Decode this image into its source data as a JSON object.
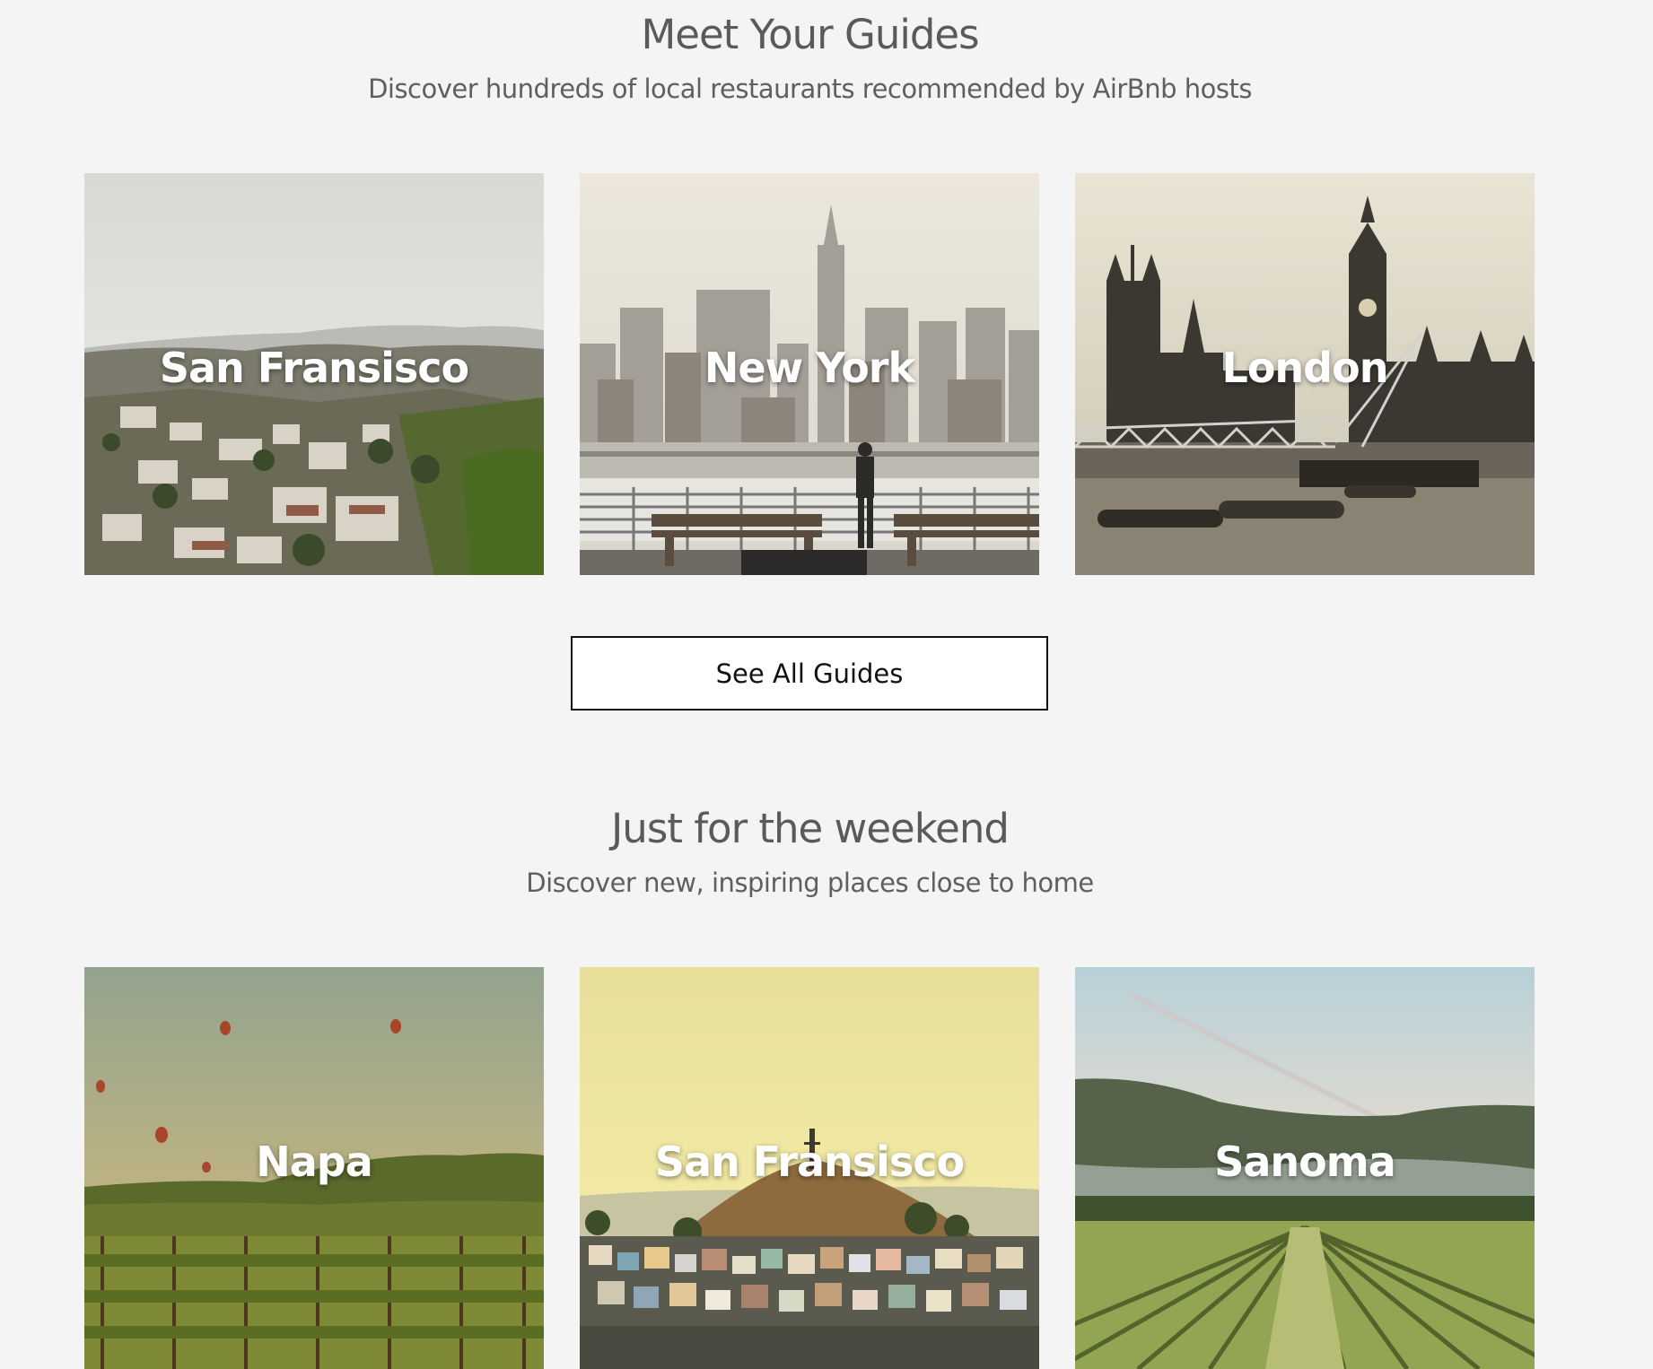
{
  "guides": {
    "title": "Meet Your Guides",
    "subtitle": "Discover hundreds of local restaurants recommended by AirBnb hosts",
    "cards": [
      {
        "label": "San Fransisco"
      },
      {
        "label": "New York"
      },
      {
        "label": "London"
      }
    ],
    "see_all_label": "See All Guides"
  },
  "weekend": {
    "title": "Just for the weekend",
    "subtitle": "Discover new, inspiring places close to home",
    "cards": [
      {
        "label": "Napa"
      },
      {
        "label": "San Fransisco"
      },
      {
        "label": "Sanoma"
      }
    ]
  }
}
